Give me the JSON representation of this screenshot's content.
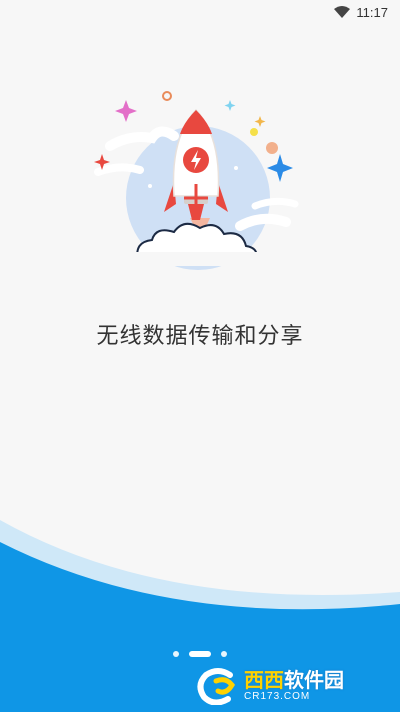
{
  "status_bar": {
    "time": "11:17",
    "wifi_icon": "wifi-icon"
  },
  "onboarding": {
    "tagline": "无线数据传输和分享",
    "illustration_icon": "rocket-launch-icon",
    "page_indicator": {
      "pages": 3,
      "current": 2
    }
  },
  "watermark": {
    "brand_cn_1": "西西",
    "brand_cn_2": "软件园",
    "site": "CR173.COM"
  },
  "colors": {
    "background": "#f7f7f7",
    "wave_blue": "#0f96e6",
    "wave_light": "#cfe8f8",
    "rocket_red": "#e8483f",
    "rocket_circle": "#cfe0f5"
  }
}
